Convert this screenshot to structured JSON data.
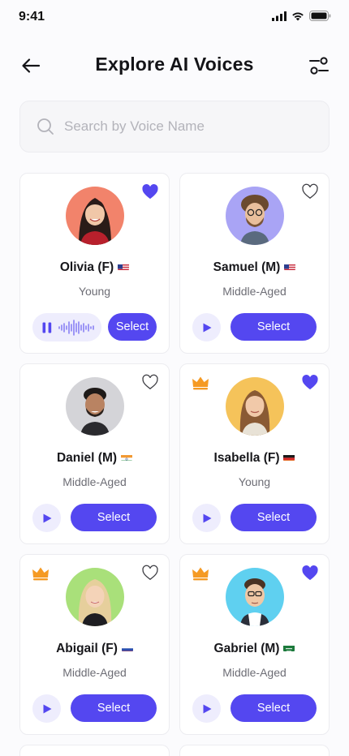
{
  "status": {
    "time": "9:41"
  },
  "header": {
    "title": "Explore AI Voices"
  },
  "search": {
    "placeholder": "Search by Voice Name",
    "value": ""
  },
  "colors": {
    "accent": "#5447f0",
    "accent_soft": "#eeedfd",
    "crown": "#f59a23"
  },
  "voices": [
    {
      "name": "Olivia (F)",
      "flag": "us-flag-icon",
      "age": "Young",
      "favorite": true,
      "premium": false,
      "playing": true,
      "select_label": "Select",
      "avatar_bg": "#f2836b"
    },
    {
      "name": "Samuel (M)",
      "flag": "us-flag-icon",
      "age": "Middle-Aged",
      "favorite": false,
      "premium": false,
      "playing": false,
      "select_label": "Select",
      "avatar_bg": "#a9a4f5"
    },
    {
      "name": "Daniel (M)",
      "flag": "india-flag-icon",
      "age": "Middle-Aged",
      "favorite": false,
      "premium": false,
      "playing": false,
      "select_label": "Select",
      "avatar_bg": "#d4d4d8"
    },
    {
      "name": "Isabella (F)",
      "flag": "germany-flag-icon",
      "age": "Young",
      "favorite": true,
      "premium": true,
      "playing": false,
      "select_label": "Select",
      "avatar_bg": "#f5c35a"
    },
    {
      "name": "Abigail (F)",
      "flag": "russia-flag-icon",
      "age": "Middle-Aged",
      "favorite": false,
      "premium": true,
      "playing": false,
      "select_label": "Select",
      "avatar_bg": "#a9e07a"
    },
    {
      "name": "Gabriel (M)",
      "flag": "saudi-flag-icon",
      "age": "Middle-Aged",
      "favorite": true,
      "premium": true,
      "playing": false,
      "select_label": "Select",
      "avatar_bg": "#5fd0f0"
    }
  ]
}
